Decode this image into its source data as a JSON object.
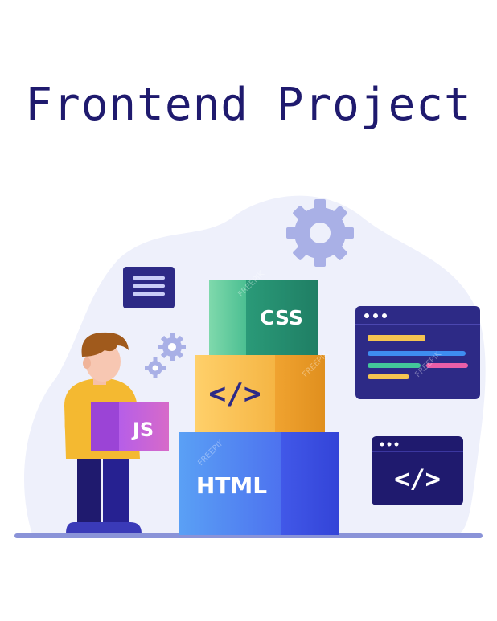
{
  "title": "Frontend Project",
  "illustration": {
    "css_label": "CSS",
    "code_label": "</>",
    "html_label": "HTML",
    "js_label": "JS",
    "window_code_label": "</>",
    "watermark": "FREEPIK",
    "icons": [
      "gear-icon",
      "document-lines-icon",
      "code-window-icon",
      "browser-window-icon"
    ]
  },
  "colors": {
    "title": "#1f1a6e",
    "background_blob": "#eef0fb",
    "css_box": "#2f9e7a",
    "code_box": "#f2a73b",
    "html_box": "#3f57e6",
    "gear": "#a9b0e6",
    "window_dark": "#1f1a6e"
  }
}
